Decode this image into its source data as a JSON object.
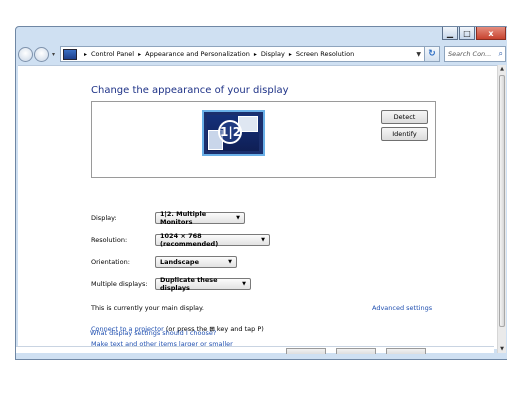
{
  "window": {
    "caption": {
      "minimize": "▁",
      "maximize": "□",
      "close": "x"
    }
  },
  "address_bar": {
    "crumbs": [
      "Control Panel",
      "Appearance and Personalization",
      "Display",
      "Screen Resolution"
    ],
    "separator": "▸",
    "refresh_icon": "refresh-icon",
    "search_placeholder": "Search Con..."
  },
  "page": {
    "heading": "Change the appearance of your display",
    "preview": {
      "monitor_label": "1|2",
      "detect_label": "Detect",
      "identify_label": "Identify"
    },
    "settings": {
      "display": {
        "label": "Display:",
        "value": "1|2. Multiple Monitors"
      },
      "resolution": {
        "label": "Resolution:",
        "value": "1024 × 768 (recommended)"
      },
      "orientation": {
        "label": "Orientation:",
        "value": "Landscape"
      },
      "multiple_displays": {
        "label": "Multiple displays:",
        "value": "Duplicate these displays"
      }
    },
    "main_display_text": "This is currently your main display.",
    "advanced_settings": "Advanced settings",
    "projector_link": "Connect to a projector",
    "projector_text": " (or press the ",
    "projector_key": "key and tap P)",
    "text_size_link": "Make text and other items larger or smaller",
    "help_link": "What display settings should I choose?"
  },
  "colors": {
    "heading": "#1e3287",
    "link": "#1f4fb0",
    "frame": "#cfe0f2"
  }
}
